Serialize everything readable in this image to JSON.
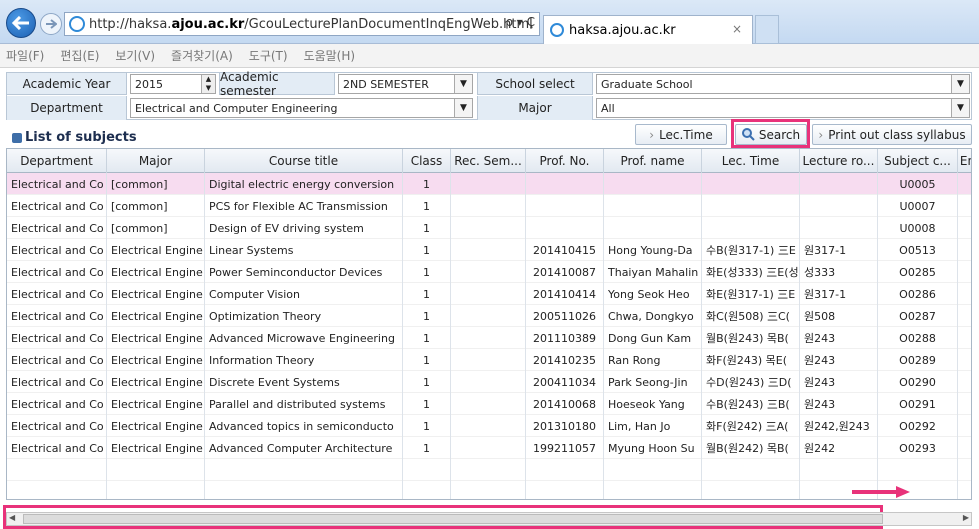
{
  "browser": {
    "url_prefix": "http://haksa.",
    "url_domain": "ajou.ac.kr",
    "url_suffix": "/GcouLecturePlanDocumentInqEngWeb.html",
    "address_tools": "ρ ▾ Ç",
    "tab_title": "haksa.ajou.ac.kr",
    "tab_close": "×"
  },
  "menu": [
    "파일(F)",
    "편집(E)",
    "보기(V)",
    "즐겨찾기(A)",
    "도구(T)",
    "도움말(H)"
  ],
  "filters": {
    "academic_year_label": "Academic Year",
    "academic_year_value": "2015",
    "academic_semester_label": "Academic semester",
    "academic_semester_value": "2ND SEMESTER",
    "school_select_label": "School select",
    "school_select_value": "Graduate School",
    "department_label": "Department",
    "department_value": "Electrical and Computer Engineering",
    "major_label": "Major",
    "major_value": "All"
  },
  "list": {
    "title": "List of subjects",
    "lec_time_button": "Lec.Time",
    "search_button": "Search",
    "print_button": "Print out class syllabus"
  },
  "table": {
    "columns": [
      "Department",
      "Major",
      "Course title",
      "Class",
      "Rec. Sem...",
      "Prof. No.",
      "Prof. name",
      "Lec. Time",
      "Lecture ro...",
      "Subject c...",
      "En"
    ],
    "rows": [
      [
        "Electrical and Co",
        "[common]",
        "Digital electric energy conversion",
        "1",
        "",
        "",
        "",
        "",
        "",
        "U0005",
        ""
      ],
      [
        "Electrical and Co",
        "[common]",
        "PCS for Flexible AC Transmission",
        "1",
        "",
        "",
        "",
        "",
        "",
        "U0007",
        ""
      ],
      [
        "Electrical and Co",
        "[common]",
        "Design of EV driving system",
        "1",
        "",
        "",
        "",
        "",
        "",
        "U0008",
        ""
      ],
      [
        "Electrical and Co",
        "Electrical Engine",
        "Linear Systems",
        "1",
        "",
        "201410415",
        "Hong Young-Da",
        "수B(원317-1) 三E",
        "원317-1",
        "O0513",
        ""
      ],
      [
        "Electrical and Co",
        "Electrical Engine",
        "Power Seminconductor Devices",
        "1",
        "",
        "201410087",
        "Thaiyan Mahalin",
        "화E(성333) 三E(성",
        "성333",
        "O0285",
        ""
      ],
      [
        "Electrical and Co",
        "Electrical Engine",
        "Computer Vision",
        "1",
        "",
        "201410414",
        "Yong Seok Heo",
        "화E(원317-1) 三E",
        "원317-1",
        "O0286",
        ""
      ],
      [
        "Electrical and Co",
        "Electrical Engine",
        "Optimization Theory",
        "1",
        "",
        "200511026",
        "Chwa, Dongkyo",
        "화C(원508) 三C(",
        "원508",
        "O0287",
        ""
      ],
      [
        "Electrical and Co",
        "Electrical Engine",
        "Advanced Microwave Engineering",
        "1",
        "",
        "201110389",
        "Dong Gun Kam",
        "월B(원243) 목B(",
        "원243",
        "O0288",
        ""
      ],
      [
        "Electrical and Co",
        "Electrical Engine",
        "Information Theory",
        "1",
        "",
        "201410235",
        "Ran Rong",
        "화F(원243) 목E(",
        "원243",
        "O0289",
        ""
      ],
      [
        "Electrical and Co",
        "Electrical Engine",
        "Discrete Event Systems",
        "1",
        "",
        "200411034",
        "Park Seong-Jin",
        "수D(원243) 三D(",
        "원243",
        "O0290",
        ""
      ],
      [
        "Electrical and Co",
        "Electrical Engine",
        "Parallel and distributed systems",
        "1",
        "",
        "201410068",
        "Hoeseok Yang",
        "수B(원243) 三B(",
        "원243",
        "O0291",
        ""
      ],
      [
        "Electrical and Co",
        "Electrical Engine",
        "Advanced topics in semiconducto",
        "1",
        "",
        "201310180",
        "Lim, Han Jo",
        "화F(원242) 三A(",
        "원242,원243",
        "O0292",
        ""
      ],
      [
        "Electrical and Co",
        "Electrical Engine",
        "Advanced Computer Architecture",
        "1",
        "",
        "199211057",
        "Myung Hoon Su",
        "월B(원242) 목B(",
        "원242",
        "O0293",
        ""
      ]
    ]
  },
  "colors": {
    "highlight": "#e8327a",
    "selected_row": "#f7dcf0"
  }
}
